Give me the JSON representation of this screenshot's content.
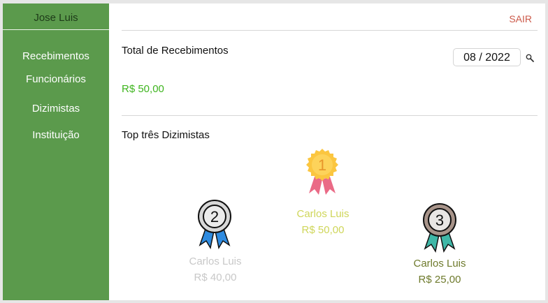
{
  "sidebar": {
    "user": "Jose Luis",
    "items": [
      {
        "label": "Recebimentos"
      },
      {
        "label": "Funcionários"
      },
      {
        "label": "Dizimistas"
      },
      {
        "label": "Instituição"
      }
    ]
  },
  "header": {
    "logout_label": "SAIR"
  },
  "summary": {
    "title": "Total de Recebimentos",
    "period": "08 / 2022",
    "total": "R$ 50,00"
  },
  "top": {
    "title": "Top três Dizimistas",
    "ranks": [
      {
        "position": "1",
        "name": "Carlos Luis",
        "value": "R$ 50,00",
        "color": "#cfd65a"
      },
      {
        "position": "2",
        "name": "Carlos Luis",
        "value": "R$ 40,00",
        "color": "#c8c8c8"
      },
      {
        "position": "3",
        "name": "Carlos Luis",
        "value": "R$ 25,00",
        "color": "#6e7a2c"
      }
    ]
  },
  "colors": {
    "sidebar": "#5b9a4c",
    "accent": "#3fb51f",
    "logout": "#cc5a4a"
  }
}
